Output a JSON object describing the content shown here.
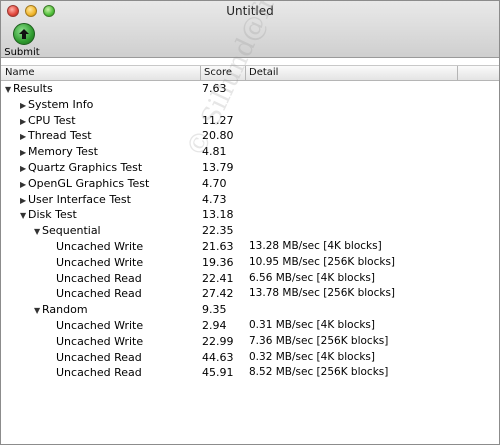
{
  "window": {
    "title": "Untitled"
  },
  "toolbar": {
    "submit_label": "Submit"
  },
  "columns": {
    "name": "Name",
    "score": "Score",
    "detail": "Detail"
  },
  "watermark": "© Sillund@free.fr",
  "rows": [
    {
      "name": "Results",
      "score": "7.63",
      "detail": "",
      "level": 0,
      "expander": "open"
    },
    {
      "name": "System Info",
      "score": "",
      "detail": "",
      "level": 1,
      "expander": "closed"
    },
    {
      "name": "CPU Test",
      "score": "11.27",
      "detail": "",
      "level": 1,
      "expander": "closed"
    },
    {
      "name": "Thread Test",
      "score": "20.80",
      "detail": "",
      "level": 1,
      "expander": "closed"
    },
    {
      "name": "Memory Test",
      "score": "4.81",
      "detail": "",
      "level": 1,
      "expander": "closed"
    },
    {
      "name": "Quartz Graphics Test",
      "score": "13.79",
      "detail": "",
      "level": 1,
      "expander": "closed"
    },
    {
      "name": "OpenGL Graphics Test",
      "score": "4.70",
      "detail": "",
      "level": 1,
      "expander": "closed"
    },
    {
      "name": "User Interface Test",
      "score": "4.73",
      "detail": "",
      "level": 1,
      "expander": "closed"
    },
    {
      "name": "Disk Test",
      "score": "13.18",
      "detail": "",
      "level": 1,
      "expander": "open"
    },
    {
      "name": "Sequential",
      "score": "22.35",
      "detail": "",
      "level": 2,
      "expander": "open"
    },
    {
      "name": "Uncached Write",
      "score": "21.63",
      "detail": "13.28 MB/sec [4K blocks]",
      "level": 3,
      "expander": ""
    },
    {
      "name": "Uncached Write",
      "score": "19.36",
      "detail": "10.95 MB/sec [256K blocks]",
      "level": 3,
      "expander": ""
    },
    {
      "name": "Uncached Read",
      "score": "22.41",
      "detail": "6.56 MB/sec [4K blocks]",
      "level": 3,
      "expander": ""
    },
    {
      "name": "Uncached Read",
      "score": "27.42",
      "detail": "13.78 MB/sec [256K blocks]",
      "level": 3,
      "expander": ""
    },
    {
      "name": "Random",
      "score": "9.35",
      "detail": "",
      "level": 2,
      "expander": "open"
    },
    {
      "name": "Uncached Write",
      "score": "2.94",
      "detail": "0.31 MB/sec [4K blocks]",
      "level": 3,
      "expander": ""
    },
    {
      "name": "Uncached Write",
      "score": "22.99",
      "detail": "7.36 MB/sec [256K blocks]",
      "level": 3,
      "expander": ""
    },
    {
      "name": "Uncached Read",
      "score": "44.63",
      "detail": "0.32 MB/sec [4K blocks]",
      "level": 3,
      "expander": ""
    },
    {
      "name": "Uncached Read",
      "score": "45.91",
      "detail": "8.52 MB/sec [256K blocks]",
      "level": 3,
      "expander": ""
    }
  ]
}
